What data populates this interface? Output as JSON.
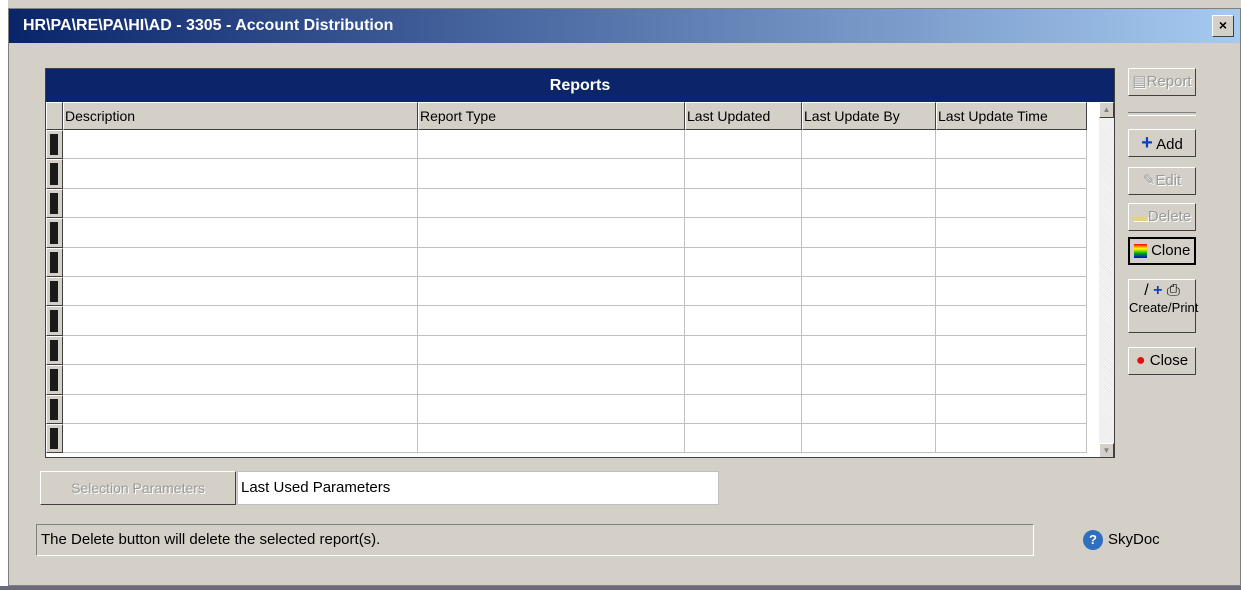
{
  "window": {
    "title": "HR\\PA\\RE\\PA\\HI\\AD - 3305 - Account Distribution",
    "close_glyph": "×"
  },
  "grid": {
    "title": "Reports",
    "columns": [
      "Description",
      "Report Type",
      "Last Updated",
      "Last Update By",
      "Last Update Time"
    ],
    "row_count": 11
  },
  "side_buttons": {
    "report": "Report",
    "add": "Add",
    "edit": "Edit",
    "delete": "Delete",
    "clone": "Clone",
    "create": "Create",
    "print": "Print",
    "close": "Close"
  },
  "selection_parameters": {
    "button_label": "Selection Parameters",
    "value": "Last Used Parameters"
  },
  "status_text": "The Delete button will delete the selected report(s).",
  "help": {
    "label": "SkyDoc",
    "glyph": "?"
  },
  "colors": {
    "grid_title_bg": "#0c246a",
    "add_icon": "#1040c0",
    "close_icon": "#e01010"
  },
  "icons": [
    "report-icon",
    "add-icon",
    "edit-icon",
    "delete-icon",
    "clone-icon",
    "pencil-icon",
    "printer-icon",
    "close-dot-icon",
    "help-icon"
  ]
}
